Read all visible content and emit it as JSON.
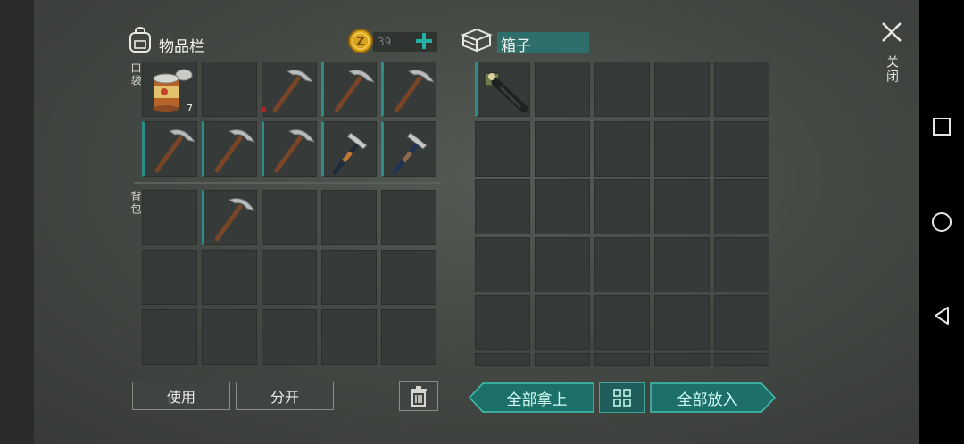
{
  "inventory": {
    "title": "物品栏",
    "coins": "39",
    "pocket_label": "口袋",
    "backpack_label": "背包",
    "can_quantity": "7"
  },
  "box": {
    "title": "箱子"
  },
  "close_label": "关闭",
  "buttons": {
    "use": "使用",
    "split": "分开",
    "take_all": "全部拿上",
    "put_all": "全部放入"
  },
  "colors": {
    "accent": "#2c8c8a",
    "teal_button": "#1d6f6a",
    "coin": "#d9a320"
  },
  "icons": [
    "backpack-icon",
    "coin-icon",
    "plus-icon",
    "box-icon",
    "close-icon",
    "trash-icon",
    "grid-icon",
    "pickaxe-icon",
    "hammer-icon",
    "canned-food-icon",
    "flashlight-icon"
  ]
}
